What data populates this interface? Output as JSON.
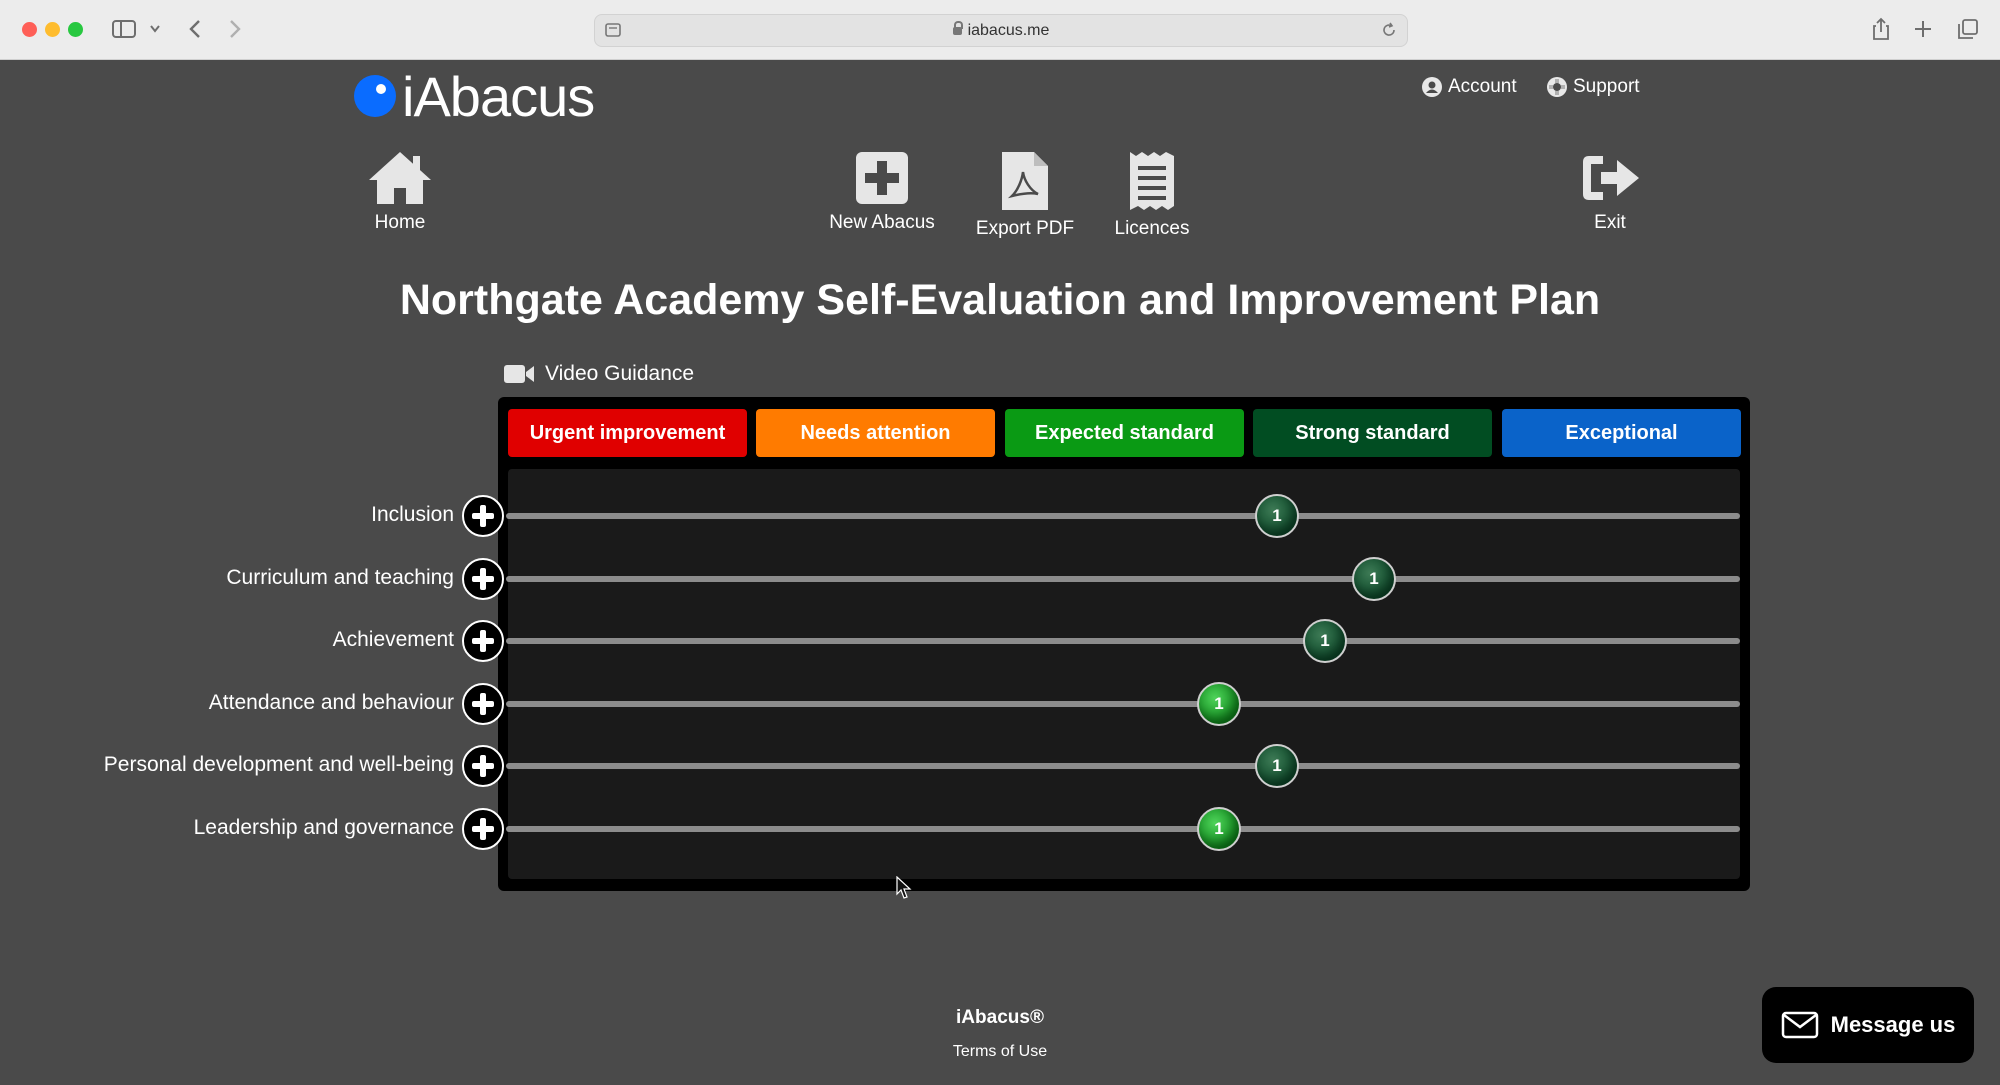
{
  "browser": {
    "url": "iabacus.me"
  },
  "header": {
    "logo_text": "iAbacus",
    "account_label": "Account",
    "support_label": "Support"
  },
  "nav": {
    "home": "Home",
    "new_abacus": "New Abacus",
    "export_pdf": "Export PDF",
    "licences": "Licences",
    "exit": "Exit"
  },
  "page": {
    "title": "Northgate Academy Self-Evaluation and Improvement Plan",
    "video_guidance": "Video Guidance"
  },
  "stages": [
    {
      "label": "Urgent improvement",
      "color": "#e00000"
    },
    {
      "label": "Needs attention",
      "color": "#ff7b00"
    },
    {
      "label": "Expected standard",
      "color": "#0a9a14"
    },
    {
      "label": "Strong standard",
      "color": "#014d22"
    },
    {
      "label": "Exceptional",
      "color": "#0a63c9"
    }
  ],
  "rows": [
    {
      "label": "Inclusion",
      "bead": "1",
      "value": 0.625,
      "shade": "dark"
    },
    {
      "label": "Curriculum and teaching",
      "bead": "1",
      "value": 0.703,
      "shade": "dark"
    },
    {
      "label": "Achievement",
      "bead": "1",
      "value": 0.664,
      "shade": "dark"
    },
    {
      "label": "Attendance and behaviour",
      "bead": "1",
      "value": 0.578,
      "shade": "light"
    },
    {
      "label": "Personal development and well-being",
      "bead": "1",
      "value": 0.625,
      "shade": "dark"
    },
    {
      "label": "Leadership and governance",
      "bead": "1",
      "value": 0.578,
      "shade": "light"
    }
  ],
  "footer": {
    "brand": "iAbacus®",
    "terms": "Terms of Use",
    "message_button": "Message us"
  }
}
